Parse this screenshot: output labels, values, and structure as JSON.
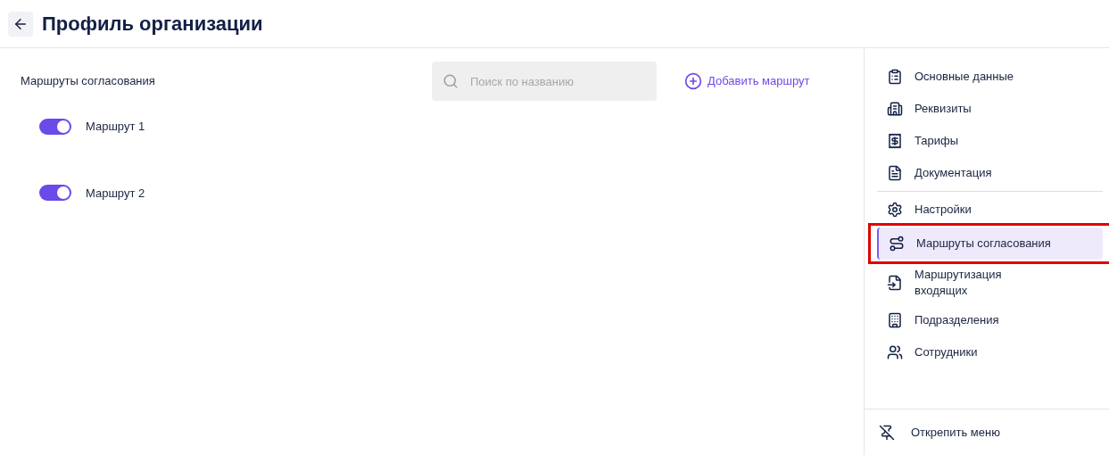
{
  "header": {
    "title": "Профиль организации"
  },
  "routes": {
    "title": "Маршруты согласования",
    "search": {
      "placeholder": "Поиск по названию"
    },
    "add_button": "Добавить маршрут",
    "items": [
      {
        "name": "Маршрут 1",
        "on": true
      },
      {
        "name": "Маршрут 2",
        "on": true
      }
    ]
  },
  "sidebar": {
    "groups": [
      {
        "items": [
          {
            "label": "Основные данные",
            "selected": false,
            "highlighted": false
          },
          {
            "label": "Реквизиты",
            "selected": false,
            "highlighted": false
          },
          {
            "label": "Тарифы",
            "selected": false,
            "highlighted": false
          },
          {
            "label": "Документация",
            "selected": false,
            "highlighted": false
          }
        ]
      },
      {
        "items": [
          {
            "label": "Настройки",
            "selected": false,
            "highlighted": false
          },
          {
            "label": "Маршруты согласования",
            "selected": true,
            "highlighted": true
          },
          {
            "label": "Маршрутизация входящих",
            "selected": false,
            "highlighted": false
          },
          {
            "label": "Подразделения",
            "selected": false,
            "highlighted": false
          },
          {
            "label": "Сотрудники",
            "selected": false,
            "highlighted": false
          }
        ]
      }
    ],
    "unpin": "Открепить меню"
  }
}
